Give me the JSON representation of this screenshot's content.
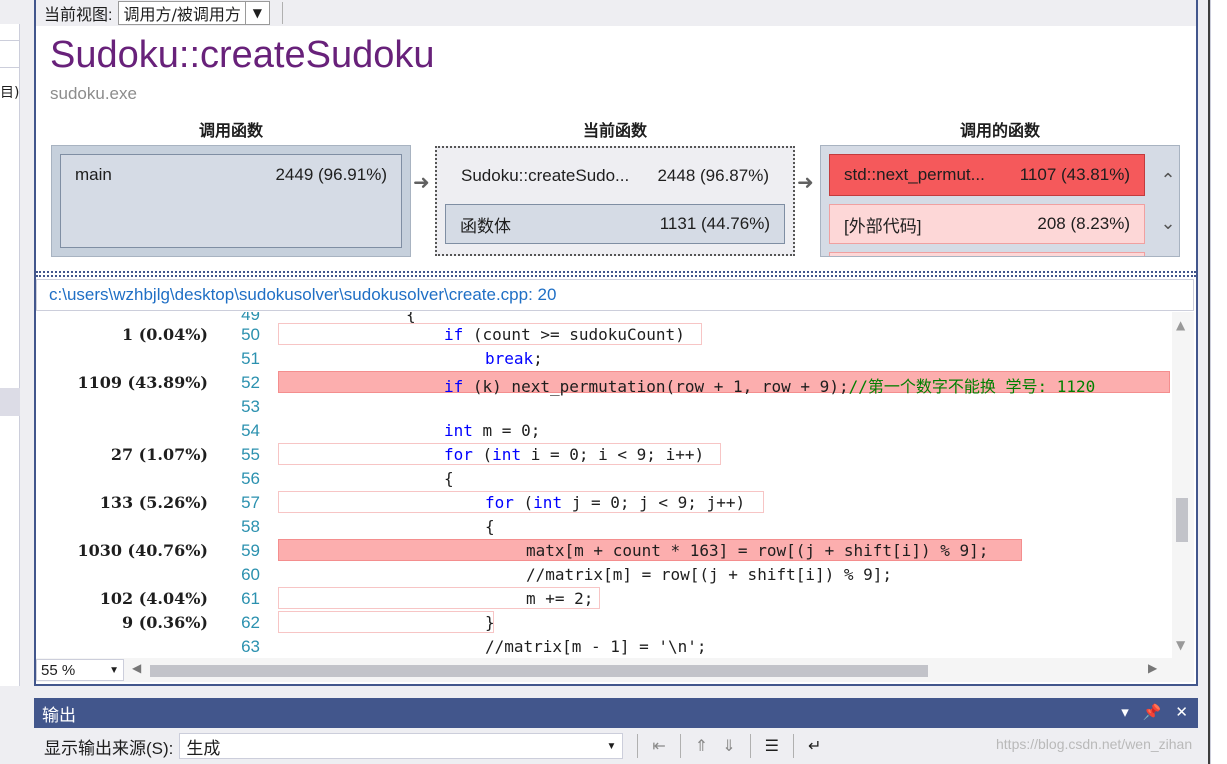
{
  "toolbar": {
    "view_label": "当前视图:",
    "view_value": "调用方/被调用方"
  },
  "header": {
    "function_name": "Sudoku::createSudoku",
    "module": "sudoku.exe"
  },
  "columns": {
    "callers": "调用函数",
    "current": "当前函数",
    "callees": "调用的函数"
  },
  "callers": [
    {
      "name": "main",
      "value": "2449 (96.91%)"
    }
  ],
  "current": {
    "name": "Sudoku::createSudo...",
    "value": "2448 (96.87%)",
    "body_name": "函数体",
    "body_value": "1131 (44.76%)"
  },
  "callees": [
    {
      "name": "std::next_permut...",
      "value": "1107 (43.81%)"
    },
    {
      "name": "[外部代码]",
      "value": "208 (8.23%)"
    }
  ],
  "source": {
    "path": "c:\\users\\wzhbjlg\\desktop\\sudokusolver\\sudokusolver\\create.cpp: 20"
  },
  "code_lines": [
    {
      "ln": "50",
      "count": "1 (0.04%)"
    },
    {
      "ln": "51",
      "count": ""
    },
    {
      "ln": "52",
      "count": "1109 (43.89%)"
    },
    {
      "ln": "53",
      "count": ""
    },
    {
      "ln": "54",
      "count": ""
    },
    {
      "ln": "55",
      "count": "27 (1.07%)"
    },
    {
      "ln": "56",
      "count": ""
    },
    {
      "ln": "57",
      "count": "133 (5.26%)"
    },
    {
      "ln": "58",
      "count": ""
    },
    {
      "ln": "59",
      "count": "1030 (40.76%)"
    },
    {
      "ln": "60",
      "count": ""
    },
    {
      "ln": "61",
      "count": "102 (4.04%)"
    },
    {
      "ln": "62",
      "count": "9 (0.36%)"
    },
    {
      "ln": "63",
      "count": ""
    }
  ],
  "zoom": {
    "value": "55 %"
  },
  "output": {
    "title": "输出",
    "source_label": "显示输出来源(S):",
    "source_value": "生成",
    "icons": [
      "pin-icon",
      "close-icon",
      "find-message-icon",
      "clear-icon",
      "word-wrap-icon"
    ]
  },
  "watermark": "https://blog.csdn.net/wen_zihan",
  "colors": {
    "hot": "#f5595b",
    "warm": "#fcaeae",
    "accent": "#42568c",
    "title": "#68217a"
  }
}
